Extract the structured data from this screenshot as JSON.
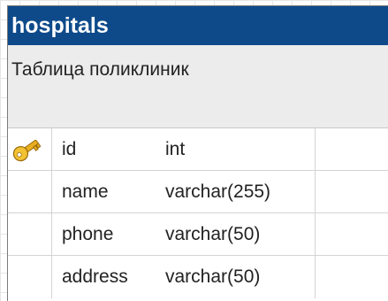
{
  "entity": {
    "name": "hospitals",
    "comment": "Таблица поликлиник",
    "fields": [
      {
        "name": "id",
        "type": "int",
        "primary_key": true,
        "icon": "key-icon"
      },
      {
        "name": "name",
        "type": "varchar(255)",
        "primary_key": false
      },
      {
        "name": "phone",
        "type": "varchar(50)",
        "primary_key": false
      },
      {
        "name": "address",
        "type": "varchar(50)",
        "primary_key": false
      }
    ]
  },
  "colors": {
    "header_bg": "#0e4a8a",
    "header_text": "#ffffff",
    "comment_bg": "#ececec",
    "key_icon": "#e8b020"
  }
}
